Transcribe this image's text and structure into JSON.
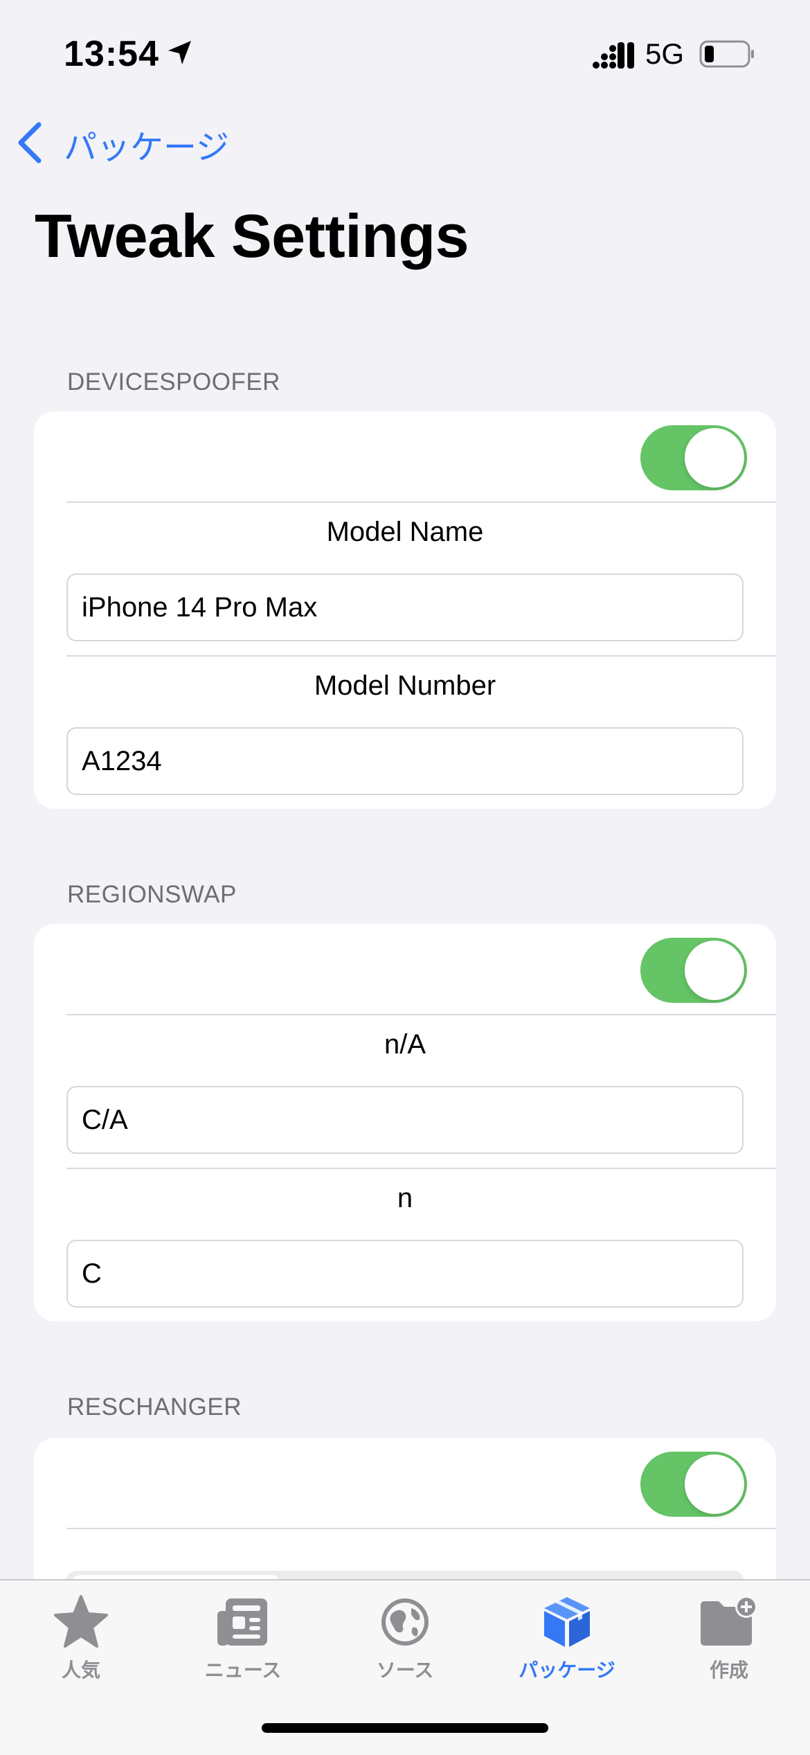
{
  "status_bar": {
    "time": "13:54",
    "network": "5G"
  },
  "nav": {
    "back_label": "パッケージ"
  },
  "page": {
    "title": "Tweak Settings"
  },
  "sections": [
    {
      "header": "DEVICESPOOFER",
      "toggle_on": true,
      "fields": [
        {
          "label": "Model Name",
          "value": "iPhone 14 Pro Max"
        },
        {
          "label": "Model Number",
          "value": "A1234"
        }
      ]
    },
    {
      "header": "REGIONSWAP",
      "toggle_on": true,
      "fields": [
        {
          "label": "n/A",
          "value": "C/A"
        },
        {
          "label": "n",
          "value": "C"
        }
      ]
    },
    {
      "header": "RESCHANGER",
      "toggle_on": true,
      "fields": []
    }
  ],
  "tab_bar": {
    "tabs": [
      {
        "label": "人気",
        "icon": "star-icon"
      },
      {
        "label": "ニュース",
        "icon": "newspaper-icon"
      },
      {
        "label": "ソース",
        "icon": "globe-icon"
      },
      {
        "label": "パッケージ",
        "icon": "package-icon",
        "active": true
      },
      {
        "label": "作成",
        "icon": "folder-plus-icon"
      }
    ]
  },
  "colors": {
    "accent": "#3478f6",
    "toggle_on": "#65c466",
    "background": "#f2f2f7",
    "tab_inactive": "#8e8e93"
  }
}
